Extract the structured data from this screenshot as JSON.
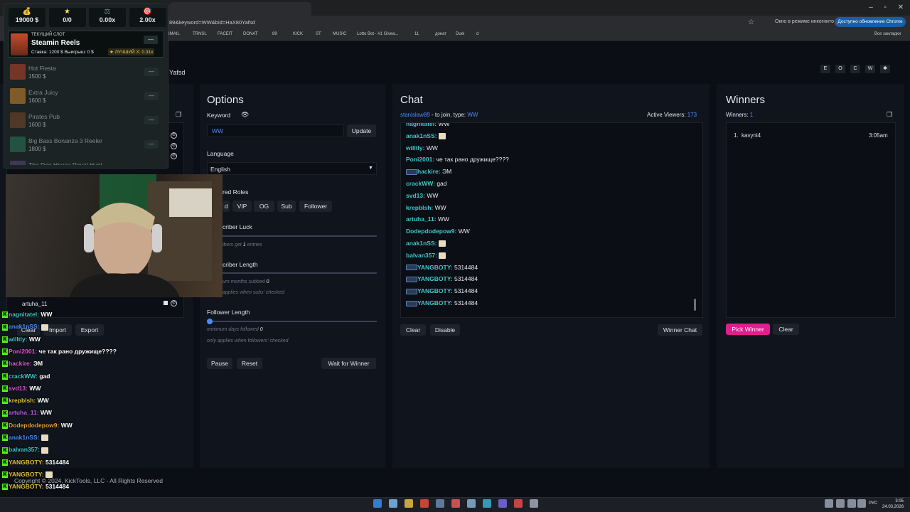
{
  "browser": {
    "tab_title": "",
    "url": "89&keyword=WW&bid=HaX80Yafsd",
    "incognito_label": "Окно в режиме инкогнито",
    "update_label": "Доступно обновление Chrome",
    "all_bookmarks": "Все закладки",
    "bookmarks": [
      "GMAIL",
      "TRNSL",
      "FACEIT",
      "DONAT",
      "89",
      "KICK",
      "ST",
      "MUSIC",
      "Lotto Bot - #1 Givea...",
      "11",
      "донат",
      "Duel",
      "d"
    ]
  },
  "page": {
    "id_label": "Yafsd",
    "hotkeys": [
      "E",
      "O",
      "C",
      "W",
      "✱"
    ],
    "footer": "Copyright © 2024, KickTools, LLC - All Rights Reserved"
  },
  "slot_overlay": {
    "stats": [
      {
        "icon": "money-bag-icon",
        "glyph": "💰",
        "value": "19000 $"
      },
      {
        "icon": "star-icon",
        "glyph": "★",
        "value": "0/0"
      },
      {
        "icon": "scales-icon",
        "glyph": "⚖",
        "value": "0.00x"
      },
      {
        "icon": "target-icon",
        "glyph": "🎯",
        "value": "2.00x"
      }
    ],
    "current_label": "ТЕКУЩИЙ СЛОТ",
    "current_name": "Steamin Reels",
    "current_bet": "Ставка: 1200 $",
    "current_win": "Выигрыш: 0 $",
    "current_best": "★ ЛУЧШИЙ Х: 0.31x",
    "slots": [
      {
        "name": "Hot Fiesta",
        "price": "1500 $",
        "color": "#c0452a"
      },
      {
        "name": "Extra Juicy",
        "price": "1600 $",
        "color": "#d08a2a"
      },
      {
        "name": "Pirates Pub",
        "price": "1600 $",
        "color": "#7a4a2a"
      },
      {
        "name": "Big Bass Bonanza 3 Reeler",
        "price": "1800 $",
        "color": "#2a7a5a"
      },
      {
        "name": "The Dog House Royal Hunt",
        "price": "",
        "color": "#5a4a7a"
      }
    ]
  },
  "entrants": {
    "visible_entry": "artuha_11",
    "clear_label": "Clear",
    "import_label": "Import",
    "export_label": "Export"
  },
  "options": {
    "title": "Options",
    "keyword_label": "Keyword",
    "keyword_value": "WW",
    "update_label": "Update",
    "language_label": "Language",
    "language_value": "English",
    "roles_label": "red Roles",
    "roles": [
      "d",
      "VIP",
      "OG",
      "Sub",
      "Follower"
    ],
    "sub_luck_label": "criber Luck",
    "sub_luck_hint_pre": "ibers get",
    "sub_luck_hint_num": "1",
    "sub_luck_hint_post": "entries",
    "sub_length_label": "criber Length",
    "sub_length_hint_pre": "um months subbed",
    "sub_length_hint_num": "0",
    "sub_length_applies": "applies when subs' checked",
    "follower_label": "Follower Length",
    "follower_hint_pre": "minimum days followed",
    "follower_hint_num": "0",
    "follower_applies": "only applies when followers' checked",
    "pause_label": "Pause",
    "reset_label": "Reset",
    "wait_label": "Wait for Winner"
  },
  "chat": {
    "title": "Chat",
    "join_user": "stanislaw89",
    "join_text": "- to join, type:",
    "join_keyword": "WW",
    "active_label": "Active Viewers:",
    "active_count": "173",
    "messages": [
      {
        "user": "nagnitatel:",
        "msg": "WW",
        "badge": false,
        "emote": false
      },
      {
        "user": "anak1nSS:",
        "msg": "",
        "badge": false,
        "emote": true
      },
      {
        "user": "willtly:",
        "msg": "WW",
        "badge": false,
        "emote": false
      },
      {
        "user": "Poni2001:",
        "msg": "че так рано дружище????",
        "badge": false,
        "emote": false
      },
      {
        "user": "hackire:",
        "msg": "ЭМ",
        "badge": true,
        "emote": false
      },
      {
        "user": "crackWW:",
        "msg": "gad",
        "badge": false,
        "emote": false
      },
      {
        "user": "svd13:",
        "msg": "WW",
        "badge": false,
        "emote": false
      },
      {
        "user": "krepblsh:",
        "msg": "WW",
        "badge": false,
        "emote": false
      },
      {
        "user": "artuha_11:",
        "msg": "WW",
        "badge": false,
        "emote": false
      },
      {
        "user": "Dodepdodepow9:",
        "msg": "WW",
        "badge": false,
        "emote": false
      },
      {
        "user": "anak1nSS:",
        "msg": "",
        "badge": false,
        "emote": true
      },
      {
        "user": "balvan357:",
        "msg": "",
        "badge": false,
        "emote": true
      },
      {
        "user": "YANGBOTY:",
        "msg": "5314484",
        "badge": true,
        "emote": false
      },
      {
        "user": "YANGBOTY:",
        "msg": "5314484",
        "badge": true,
        "emote": false
      },
      {
        "user": "YANGBOTY:",
        "msg": "5314484",
        "badge": true,
        "emote": false
      },
      {
        "user": "YANGBOTY:",
        "msg": "5314484",
        "badge": true,
        "emote": false
      }
    ],
    "clear_label": "Clear",
    "disable_label": "Disable",
    "winner_chat_label": "Winner Chat"
  },
  "winners": {
    "title": "Winners",
    "count_label": "Winners:",
    "count": "1",
    "list": [
      {
        "rank": "1.",
        "name": "kavyni4",
        "time": "3:05am"
      }
    ],
    "pick_label": "Pick Winner",
    "clear_label": "Clear"
  },
  "overlay_chat": [
    {
      "user": "nagnitatel:",
      "msg": "WW",
      "color": "#3ec7c7"
    },
    {
      "user": "anak1nSS:",
      "msg": "",
      "color": "#4a8cff"
    },
    {
      "user": "willtly:",
      "msg": "WW",
      "color": "#3ec7c7"
    },
    {
      "user": "Poni2001:",
      "msg": "че так рано дружище????",
      "color": "#e05ad6"
    },
    {
      "user": "hackire:",
      "msg": "ЭМ",
      "color": "#e05ad6"
    },
    {
      "user": "crackWW:",
      "msg": "gad",
      "color": "#3ec7c7"
    },
    {
      "user": "svd13:",
      "msg": "WW",
      "color": "#e05ad6"
    },
    {
      "user": "krepblsh:",
      "msg": "WW",
      "color": "#e0c03a"
    },
    {
      "user": "artuha_11:",
      "msg": "WW",
      "color": "#c05ae0"
    },
    {
      "user": "Dodepdodepow9:",
      "msg": "WW",
      "color": "#e0a03a"
    },
    {
      "user": "anak1nSS:",
      "msg": "",
      "color": "#4a8cff"
    },
    {
      "user": "balvan357:",
      "msg": "",
      "color": "#3ec7c7"
    },
    {
      "user": "YANGBOTY:",
      "msg": "5314484",
      "color": "#e0c03a"
    },
    {
      "user": "YANGBOTY:",
      "msg": "",
      "color": "#e0c03a"
    },
    {
      "user": "YANGBOTY:",
      "msg": "5314484",
      "color": "#e0c03a"
    }
  ],
  "taskbar": {
    "lang": "РУС",
    "time": "3:05",
    "date": "24.03.2026"
  },
  "colors": {
    "accent_pink": "#e31c8f",
    "kick_green": "#53fc18",
    "link_blue": "#4a8cff"
  }
}
